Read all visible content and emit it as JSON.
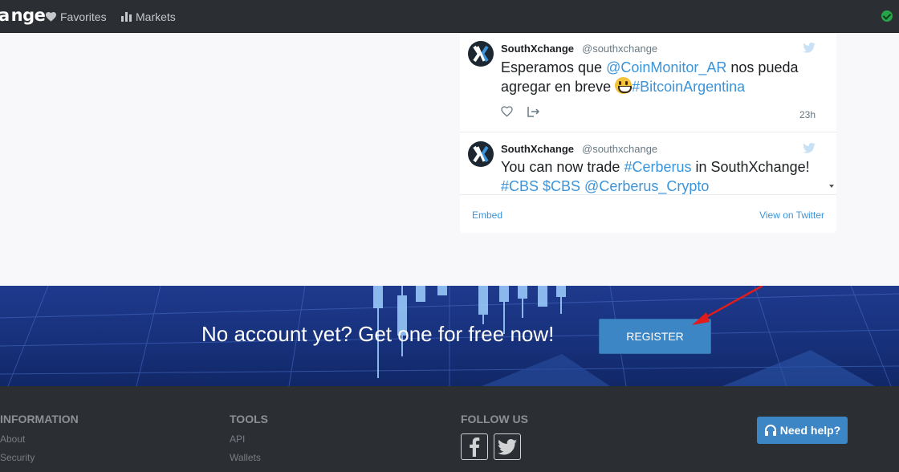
{
  "nav": {
    "brand": "nge",
    "favorites": "Favorites",
    "markets": "Markets"
  },
  "twitter": {
    "tweets": [
      {
        "name": "SouthXchange",
        "handle": "@southxchange",
        "text_parts": [
          "Esperamos que ",
          "@CoinMonitor_AR",
          " nos pueda agregar en breve ",
          "#BitcoinArgentina"
        ],
        "time": "23h"
      },
      {
        "name": "SouthXchange",
        "handle": "@southxchange",
        "text_parts": [
          "You can now trade ",
          "#Cerberus",
          " in SouthXchange!",
          "#CBS $CBS @Cerberus_Crypto"
        ]
      }
    ],
    "embed": "Embed",
    "view_on_twitter": "View on Twitter"
  },
  "banner": {
    "text": "No account yet? Get one for free now!",
    "register": "REGISTER"
  },
  "footer": {
    "information": {
      "title": "INFORMATION",
      "links": [
        "About",
        "Security"
      ]
    },
    "tools": {
      "title": "TOOLS",
      "links": [
        "API",
        "Wallets"
      ]
    },
    "follow": {
      "title": "FOLLOW US"
    },
    "help": "Need help?"
  },
  "colors": {
    "navbar": "#2b2e33",
    "accent": "#3d86c6",
    "twitter_link": "#3b94d9",
    "banner": "#1a3580"
  }
}
